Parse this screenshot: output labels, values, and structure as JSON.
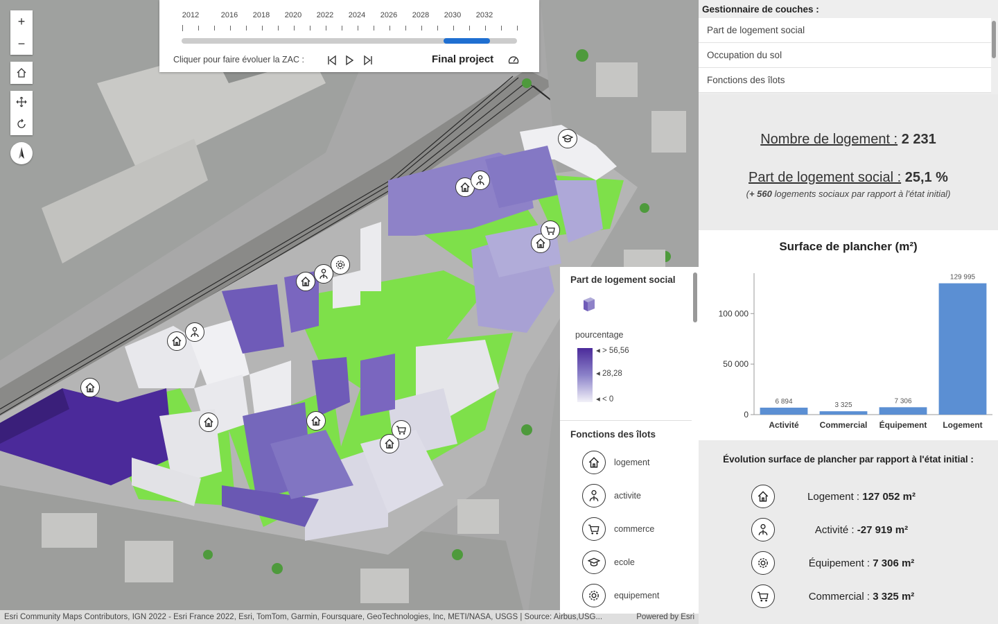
{
  "map": {
    "zoom_in": "+",
    "zoom_out": "−",
    "attribution": "Esri Community Maps Contributors, IGN 2022 - Esri France 2022, Esri, TomTom, Garmin, Foursquare, GeoTechnologies, Inc, METI/NASA, USGS | Source: Airbus,USG...",
    "powered_by": "Powered by Esri"
  },
  "timeline": {
    "years": [
      "2012",
      "2016",
      "2018",
      "2020",
      "2022",
      "2024",
      "2026",
      "2028",
      "2030",
      "2032"
    ],
    "progress": 0.92,
    "label": "Cliquer pour faire évoluer la ZAC :",
    "state": "Final project"
  },
  "legend": {
    "social_title": "Part de logement social",
    "pct_label": "pourcentage",
    "ramp_high": "> 56,56",
    "ramp_mid": "28,28",
    "ramp_low": "< 0",
    "functions_title": "Fonctions des îlots",
    "items": [
      {
        "icon": "house-icon",
        "label": "logement"
      },
      {
        "icon": "worker-icon",
        "label": "activite"
      },
      {
        "icon": "cart-icon",
        "label": "commerce"
      },
      {
        "icon": "graduation-cap-icon",
        "label": "ecole"
      },
      {
        "icon": "gear-icon",
        "label": "equipement"
      }
    ]
  },
  "layers": {
    "title": "Gestionnaire de couches :",
    "items": [
      "Part de logement social",
      "Occupation du sol",
      "Fonctions des îlots"
    ]
  },
  "stats": {
    "housing_label": "Nombre de logement :",
    "housing_value": "2 231",
    "social_label": "Part de logement social :",
    "social_value": "25,1 %",
    "note_prefix": "(",
    "note_value": "+ 560",
    "note_suffix": " logements sociaux par rapport à l'état initial)"
  },
  "chart_data": {
    "type": "bar",
    "title": "Surface de plancher (m²)",
    "categories": [
      "Activité",
      "Commercial",
      "Équipement",
      "Logement"
    ],
    "values": [
      6894,
      3325,
      7306,
      129995
    ],
    "value_labels": [
      "6 894",
      "3 325",
      "7 306",
      "129 995"
    ],
    "yticks": [
      0,
      50000,
      100000
    ],
    "ytick_labels": [
      "0",
      "50 000",
      "100 000"
    ],
    "ylim": [
      0,
      140000
    ],
    "color": "#5b8fd3"
  },
  "evolution": {
    "title": "Évolution surface de plancher par rapport à l'état initial :",
    "rows": [
      {
        "icon": "house-icon",
        "label": "Logement :",
        "value": "127 052 m²"
      },
      {
        "icon": "worker-icon",
        "label": "Activité :",
        "value": "-27 919  m²"
      },
      {
        "icon": "gear-icon",
        "label": "Équipement :",
        "value": "7 306  m²"
      },
      {
        "icon": "cart-icon",
        "label": "Commercial :",
        "value": "3 325 m²"
      }
    ]
  },
  "colors": {
    "green_space": "#7ee04a",
    "social_high": "#4b2a9a",
    "social_mid": "#8b82c9",
    "social_low": "#e8e6f2"
  }
}
